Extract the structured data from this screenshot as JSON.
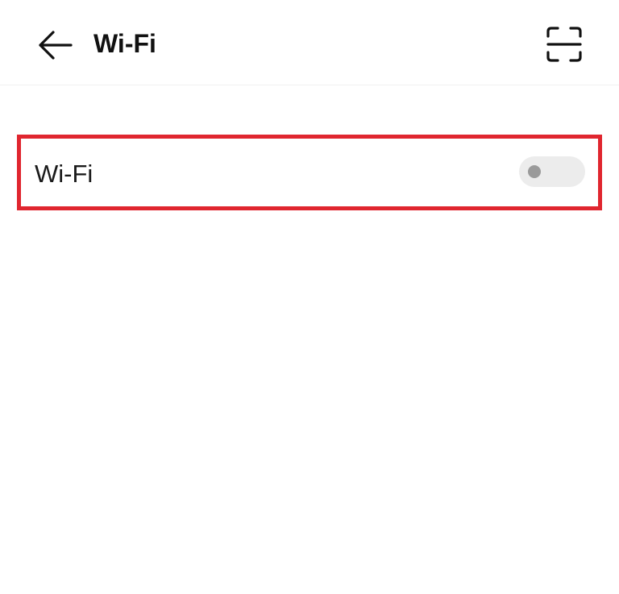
{
  "header": {
    "title": "Wi-Fi",
    "back_icon": "back-arrow-icon",
    "scan_icon": "scan-icon"
  },
  "settings": {
    "wifi_row": {
      "label": "Wi-Fi",
      "toggle_state": "off"
    }
  },
  "colors": {
    "highlight_border": "#e0262f",
    "toggle_track_off": "#ececec",
    "toggle_knob_off": "#9a9a9a"
  }
}
